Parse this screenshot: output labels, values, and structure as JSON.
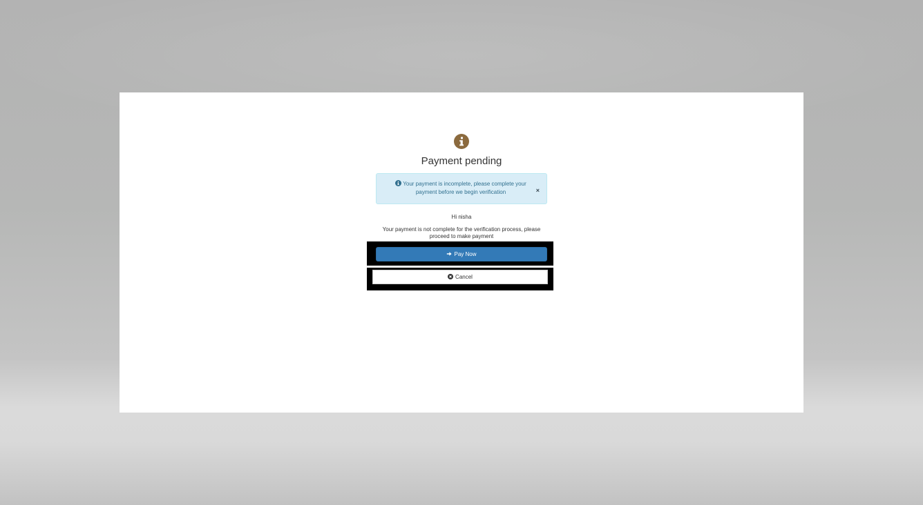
{
  "modal": {
    "icon": "info-circle-icon",
    "title": "Payment pending",
    "alert": {
      "icon": "info-circle-icon",
      "text": "Your payment is incomplete, please complete your payment before we begin verification",
      "close_label": "×"
    },
    "greeting": "Hi nisha",
    "message": "Your payment is not complete for the verification process, please proceed to make payment",
    "pay_button": {
      "icon": "arrow-right-icon",
      "label": "Pay Now"
    },
    "cancel_button": {
      "icon": "times-circle-icon",
      "label": "Cancel"
    }
  },
  "colors": {
    "primary": "#337ab7",
    "icon_brown": "#8b6a3e",
    "alert_bg": "#d9edf7",
    "alert_text": "#31708f"
  }
}
